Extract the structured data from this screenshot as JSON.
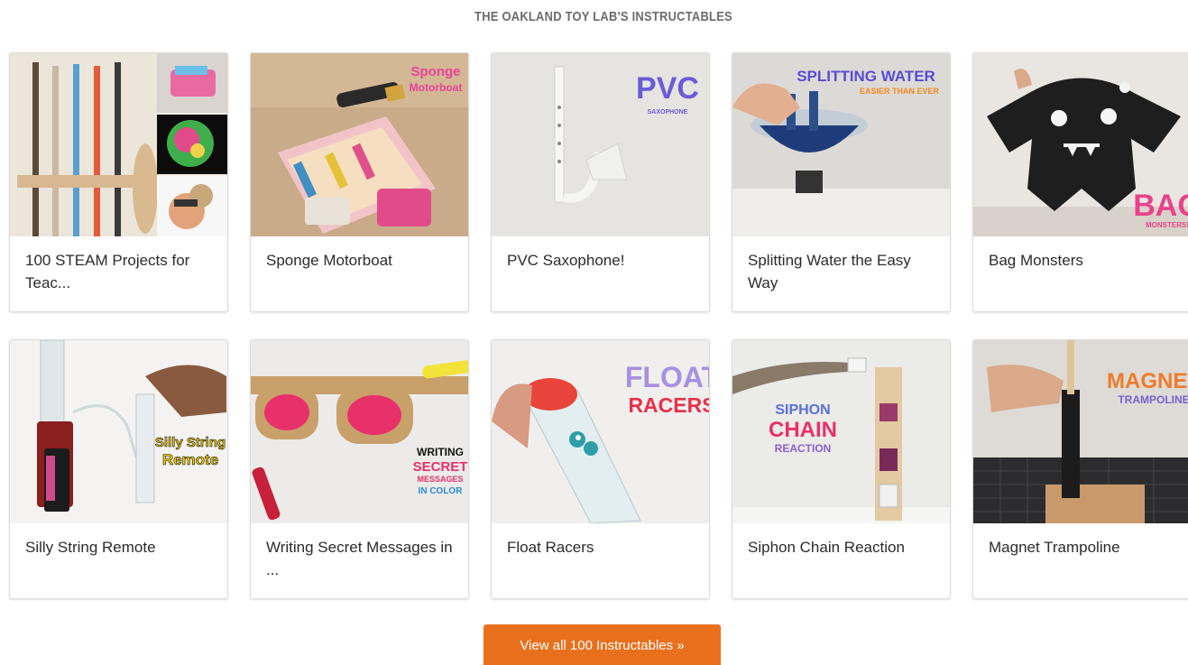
{
  "section": {
    "title": "THE OAKLAND TOY LAB'S INSTRUCTABLES"
  },
  "cards": [
    {
      "title": "100 STEAM Projects for Teac...",
      "image": "steam-projects-collage"
    },
    {
      "title": "Sponge Motorboat",
      "image": "sponge-motorboat",
      "overlay": [
        "Sponge",
        "Motorboat"
      ]
    },
    {
      "title": "PVC Saxophone!",
      "image": "pvc-saxophone",
      "overlay": [
        "PVC",
        "SAXOPHONE"
      ]
    },
    {
      "title": "Splitting Water the Easy Way",
      "image": "splitting-water",
      "overlay": [
        "SPLITTING WATER",
        "EASIER THAN EVER"
      ]
    },
    {
      "title": "Bag Monsters",
      "image": "bag-monsters",
      "overlay": [
        "BAG",
        "MONSTERS!"
      ]
    },
    {
      "title": "Silly String Remote",
      "image": "silly-string-remote",
      "overlay": [
        "Silly String",
        "Remote"
      ]
    },
    {
      "title": "Writing Secret Messages in ...",
      "image": "secret-messages",
      "overlay": [
        "WRITING",
        "SECRET",
        "MESSAGES",
        "IN COLOR"
      ]
    },
    {
      "title": "Float Racers",
      "image": "float-racers",
      "overlay": [
        "FLOAT",
        "RACERS"
      ]
    },
    {
      "title": "Siphon Chain Reaction",
      "image": "siphon-chain-reaction",
      "overlay": [
        "SIPHON",
        "CHAIN",
        "REACTION"
      ]
    },
    {
      "title": "Magnet Trampoline",
      "image": "magnet-trampoline",
      "overlay": [
        "MAGNET",
        "TRAMPOLINE"
      ]
    }
  ],
  "cta": {
    "label": "View all 100 Instructables »"
  },
  "colors": {
    "accent": "#e8701d",
    "title_gray": "#6b6b6b",
    "card_border": "#dcdcdc"
  }
}
